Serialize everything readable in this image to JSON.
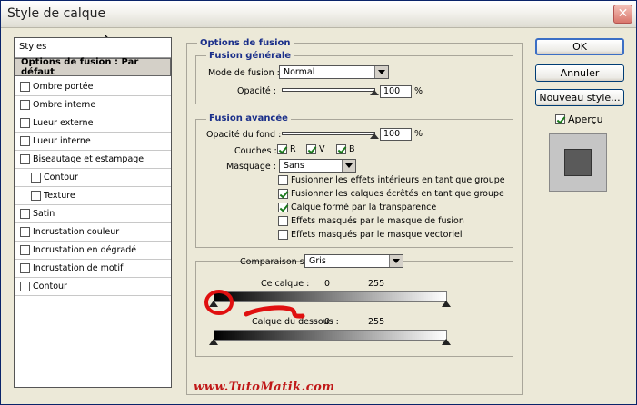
{
  "window": {
    "title": "Style de calque"
  },
  "styles_list": {
    "header": "Styles",
    "items": [
      {
        "label": "Options de fusion : Par défaut",
        "selected": true,
        "checkbox": false,
        "sub": false,
        "checked": false
      },
      {
        "label": "Ombre portée",
        "checkbox": true,
        "sub": false,
        "checked": false
      },
      {
        "label": "Ombre interne",
        "checkbox": true,
        "sub": false,
        "checked": false
      },
      {
        "label": "Lueur externe",
        "checkbox": true,
        "sub": false,
        "checked": false
      },
      {
        "label": "Lueur interne",
        "checkbox": true,
        "sub": false,
        "checked": false
      },
      {
        "label": "Biseautage et estampage",
        "checkbox": true,
        "sub": false,
        "checked": false
      },
      {
        "label": "Contour",
        "checkbox": true,
        "sub": true,
        "checked": false
      },
      {
        "label": "Texture",
        "checkbox": true,
        "sub": true,
        "checked": false
      },
      {
        "label": "Satin",
        "checkbox": true,
        "sub": false,
        "checked": false
      },
      {
        "label": "Incrustation couleur",
        "checkbox": true,
        "sub": false,
        "checked": false
      },
      {
        "label": "Incrustation en dégradé",
        "checkbox": true,
        "sub": false,
        "checked": false
      },
      {
        "label": "Incrustation de motif",
        "checkbox": true,
        "sub": false,
        "checked": false
      },
      {
        "label": "Contour",
        "checkbox": true,
        "sub": false,
        "checked": false
      }
    ]
  },
  "options": {
    "title": "Options de fusion",
    "general": {
      "title": "Fusion générale",
      "mode_label": "Mode de fusion :",
      "mode_value": "Normal",
      "opacity_label": "Opacité :",
      "opacity_value": "100",
      "percent": "%"
    },
    "advanced": {
      "title": "Fusion avancée",
      "fill_label": "Opacité du fond :",
      "fill_value": "100",
      "percent": "%",
      "channels_label": "Couches :",
      "channel_r": "R",
      "channel_v": "V",
      "channel_b": "B",
      "knockout_label": "Masquage :",
      "knockout_value": "Sans",
      "checks": [
        {
          "label": "Fusionner les effets intérieurs en tant que groupe",
          "checked": false
        },
        {
          "label": "Fusionner les calques écrêtés en tant que groupe",
          "checked": true
        },
        {
          "label": "Calque formé par la transparence",
          "checked": true
        },
        {
          "label": "Effets masqués par le masque de fusion",
          "checked": false
        },
        {
          "label": "Effets masqués par le masque vectoriel",
          "checked": false
        }
      ]
    },
    "blend_if": {
      "label": "Comparaison sur :",
      "value": "Gris",
      "this_layer": "Ce calque :",
      "this_low": "0",
      "this_high": "255",
      "underlying": "Calque du dessous :",
      "under_low": "0",
      "under_high": "255"
    }
  },
  "buttons": {
    "ok": "OK",
    "cancel": "Annuler",
    "new_style": "Nouveau style...",
    "preview_label": "Aperçu"
  },
  "watermark": "www.TutoMatik.com",
  "colors": {
    "annotation": "#e01010",
    "accent": "#1a2f8a"
  }
}
